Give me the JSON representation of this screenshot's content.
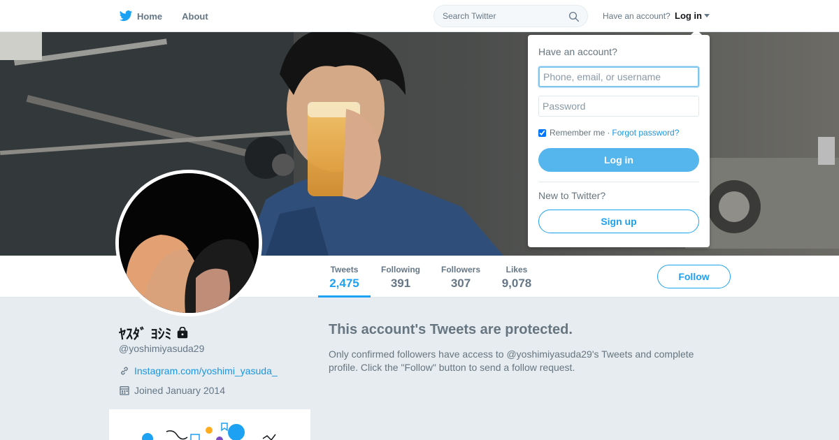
{
  "nav": {
    "home_label": "Home",
    "about_label": "About",
    "search_placeholder": "Search Twitter",
    "have_account": "Have an account?",
    "login_label": "Log in"
  },
  "profile": {
    "name": "ﾔｽﾀﾞ ﾖｼﾐ",
    "handle": "@yoshimiyasuda29",
    "website": "Instagram.com/yoshimi_yasuda_",
    "joined": "Joined January 2014",
    "protected": true
  },
  "stats": [
    {
      "label": "Tweets",
      "value": "2,475",
      "active": true
    },
    {
      "label": "Following",
      "value": "391",
      "active": false
    },
    {
      "label": "Followers",
      "value": "307",
      "active": false
    },
    {
      "label": "Likes",
      "value": "9,078",
      "active": false
    }
  ],
  "follow_label": "Follow",
  "protected_msg": {
    "title": "This account's Tweets are protected.",
    "body": "Only confirmed followers have access to @yoshimiyasuda29's Tweets and complete profile. Click the \"Follow\" button to send a follow request."
  },
  "login_dropdown": {
    "heading": "Have an account?",
    "username_placeholder": "Phone, email, or username",
    "password_placeholder": "Password",
    "remember_label": "Remember me",
    "separator": "·",
    "forgot_label": "Forgot password?",
    "remember_checked": true,
    "login_button": "Log in",
    "new_heading": "New to Twitter?",
    "signup_button": "Sign up"
  },
  "colors": {
    "accent": "#1da1f2",
    "link": "#1b95e0",
    "background": "#e6ecf0",
    "muted": "#657786"
  }
}
